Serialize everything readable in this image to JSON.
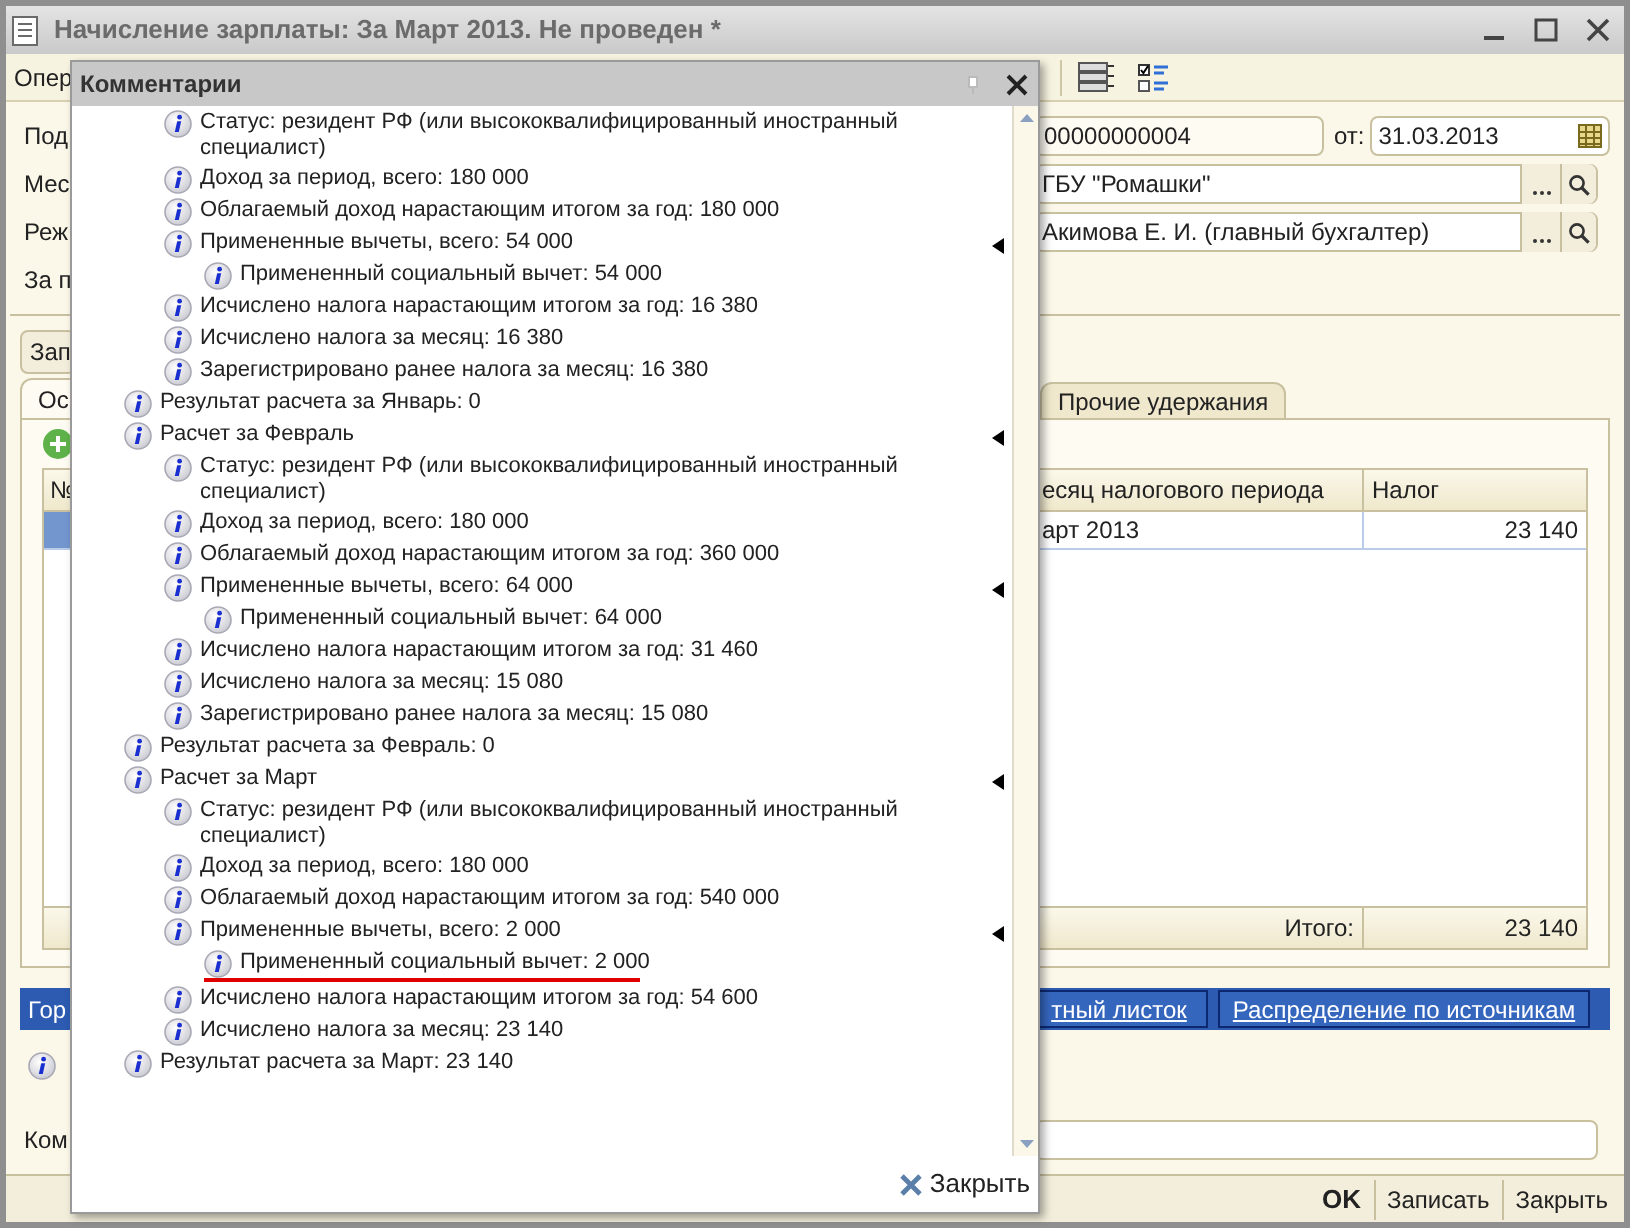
{
  "window": {
    "title": "Начисление зарплаты: За Март 2013. Не проведен *"
  },
  "toolbar": {
    "label": "Опер"
  },
  "form": {
    "number_label": "Под",
    "number": "00000000004",
    "date_label": "от:",
    "date": "31.03.2013",
    "organization_label": "Мес",
    "organization": "ГБУ \"Ромашки\"",
    "responsible_label": "Реж",
    "responsible": "Акимова Е. И. (главный бухгалтер)",
    "period_label": "За п"
  },
  "fill_button": {
    "label": "Зап"
  },
  "tabs": [
    {
      "label": "Ос",
      "selected": true
    },
    {
      "label": "Прочие удержания",
      "selected": false
    }
  ],
  "table": {
    "columns": [
      "№",
      "есяц налогового периода",
      "Налог"
    ],
    "rows": [
      {
        "month": "арт 2013",
        "tax": "23 140",
        "selected": true
      }
    ],
    "footer": {
      "label": "Итого:",
      "total": "23 140"
    }
  },
  "action_bar": {
    "label": "Гор",
    "links": [
      "тный листок",
      "Распределение по источникам"
    ]
  },
  "comment": {
    "label": "Ком"
  },
  "buttons": [
    {
      "label": "OK",
      "default": true
    },
    {
      "label": "Записать",
      "default": false
    },
    {
      "label": "Закрыть",
      "default": false
    }
  ],
  "popup": {
    "title": "Комментарии",
    "close_label": "Закрыть",
    "items": [
      {
        "children": [
          {
            "text": "Статус: резидент РФ (или высококвалифицированный иностранный специалист)"
          },
          {
            "text": "Доход за период, всего: 180 000"
          },
          {
            "text": "Облагаемый доход нарастающим итогом за год: 180 000"
          },
          {
            "text": "Примененные вычеты, всего: 54 000",
            "expanded": true,
            "children": [
              {
                "text": "Примененный социальный вычет: 54 000"
              }
            ]
          },
          {
            "text": "Исчислено налога нарастающим итогом за год: 16 380"
          },
          {
            "text": "Исчислено налога за месяц: 16 380"
          },
          {
            "text": "Зарегистрировано ранее налога за месяц: 16 380"
          }
        ]
      },
      {
        "text": "Результат расчета за Январь: 0"
      },
      {
        "text": "Расчет за Февраль",
        "expanded": true,
        "children": [
          {
            "text": "Статус: резидент РФ (или высококвалифицированный иностранный специалист)"
          },
          {
            "text": "Доход за период, всего: 180 000"
          },
          {
            "text": "Облагаемый доход нарастающим итогом за год: 360 000"
          },
          {
            "text": "Примененные вычеты, всего: 64 000",
            "expanded": true,
            "children": [
              {
                "text": "Примененный социальный вычет: 64 000"
              }
            ]
          },
          {
            "text": "Исчислено налога нарастающим итогом за год: 31 460"
          },
          {
            "text": "Исчислено налога за месяц: 15 080"
          },
          {
            "text": "Зарегистрировано ранее налога за месяц: 15 080"
          }
        ]
      },
      {
        "text": "Результат расчета за Февраль: 0"
      },
      {
        "text": "Расчет за Март",
        "expanded": true,
        "children": [
          {
            "text": "Статус: резидент РФ (или высококвалифицированный иностранный специалист)"
          },
          {
            "text": "Доход за период, всего: 180 000"
          },
          {
            "text": "Облагаемый доход нарастающим итогом за год: 540 000"
          },
          {
            "text": "Примененные вычеты, всего: 2 000",
            "expanded": true,
            "children": [
              {
                "text": "Примененный социальный вычет: 2 000",
                "underlined": true
              }
            ]
          },
          {
            "text": "Исчислено налога нарастающим итогом за год: 54 600"
          },
          {
            "text": "Исчислено налога за месяц: 23 140"
          }
        ]
      },
      {
        "text": "Результат расчета за Март: 23 140"
      }
    ]
  }
}
